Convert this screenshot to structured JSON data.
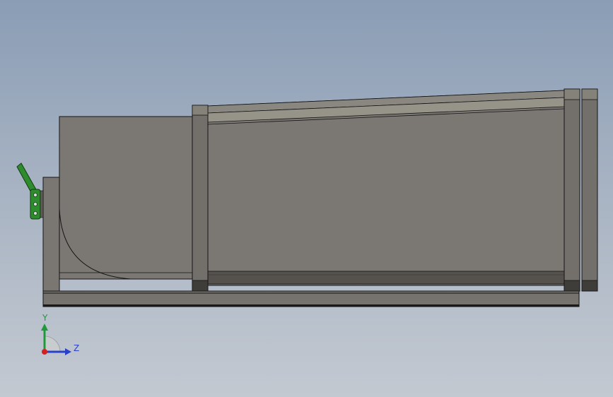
{
  "colors": {
    "body_fill": "#7b7873",
    "frame_fill": "#73706b",
    "dark_band": "#4a4844",
    "edge": "#141414",
    "handle_green": "#2e8c2e",
    "axis_y": "#1f9a3a",
    "axis_z": "#2a40c8",
    "origin": "#d42020"
  },
  "triad": {
    "y_label": "Y",
    "z_label": "Z"
  },
  "icons": {
    "triad": "view-orientation-triad-icon",
    "handle": "clamp-handle-icon"
  }
}
